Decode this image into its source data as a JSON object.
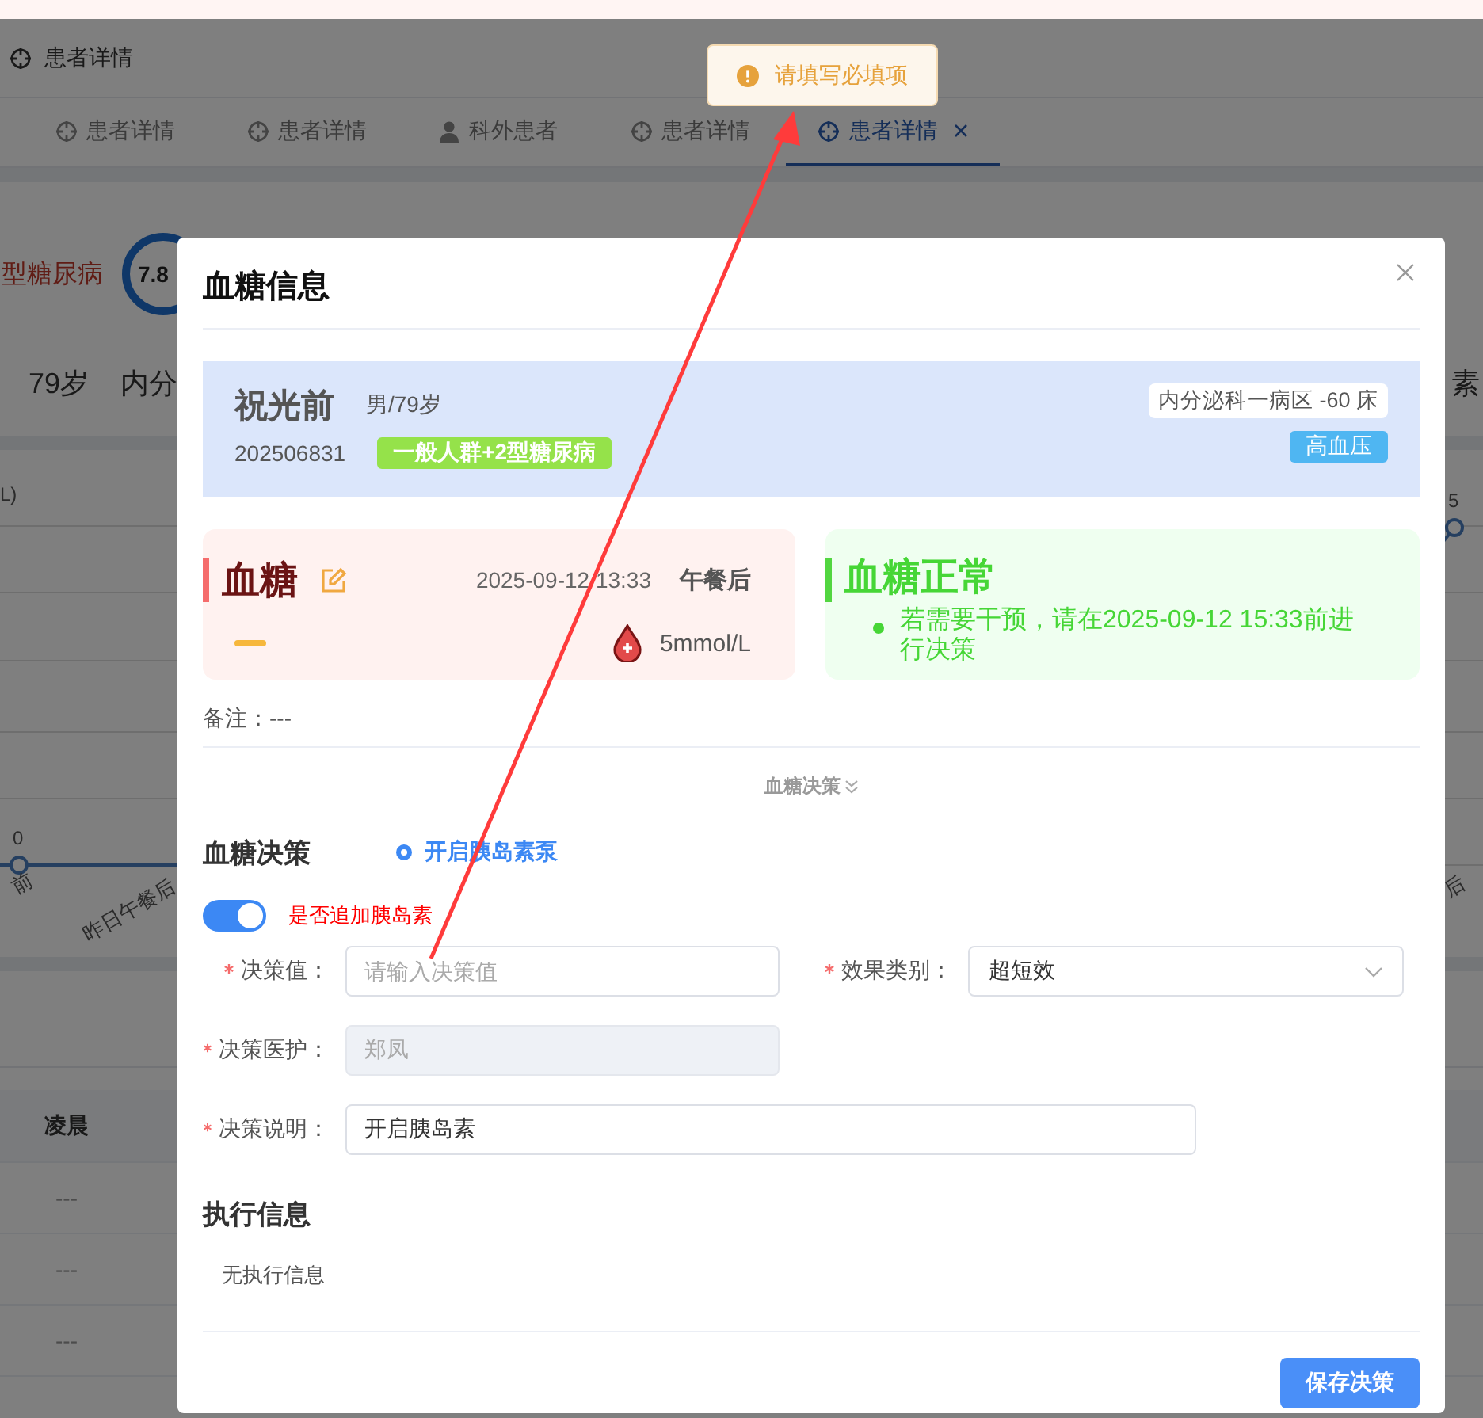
{
  "page": {
    "header_title": "患者详情",
    "tabs": [
      {
        "label": "患者详情",
        "kind": "detail",
        "selected": false,
        "closable": false
      },
      {
        "label": "患者详情",
        "kind": "detail",
        "selected": false,
        "closable": false
      },
      {
        "label": "科外患者",
        "kind": "person",
        "selected": false,
        "closable": false
      },
      {
        "label": "患者详情",
        "kind": "detail",
        "selected": false,
        "closable": false
      },
      {
        "label": "患者详情",
        "kind": "detail",
        "selected": true,
        "closable": true
      }
    ],
    "summary": {
      "diagnosis": "型糖尿病",
      "score": "7.8",
      "age": "79岁",
      "dept": "内分",
      "right_text": "素"
    },
    "chart": {
      "unit": "L)",
      "left_value": "0",
      "right_value": "5",
      "x_labels": [
        "前",
        "昨日午餐后",
        "后"
      ]
    },
    "table": {
      "columns": [
        "凌晨"
      ],
      "rows": [
        [
          "---"
        ],
        [
          "---"
        ],
        [
          "---"
        ]
      ]
    }
  },
  "toast": {
    "kind": "warning",
    "message": "请填写必填项"
  },
  "dialog": {
    "title": "血糖信息",
    "patient": {
      "name": "祝光前",
      "sex_age": "男/79岁",
      "id": "202506831",
      "group_tag": "一般人群+2型糖尿病",
      "ward": "内分泌科一病区 -60 床",
      "condition_tag": "高血压"
    },
    "reading": {
      "title": "血糖",
      "time": "2025-09-12 13:33",
      "meal": "午餐后",
      "value": "5mmol/L"
    },
    "status": {
      "title": "血糖正常",
      "advice": "若需要干预，请在2025-09-12 15:33前进行决策"
    },
    "note": "备注：---",
    "section_toggle": "血糖决策",
    "decision": {
      "title": "血糖决策",
      "option": {
        "label": "开启胰岛素泵",
        "selected": true
      },
      "add_insulin": {
        "label": "是否追加胰岛素",
        "on": true
      },
      "rows": [
        [
          {
            "label": "决策值：",
            "required": true,
            "kind": "input",
            "placeholder": "请输入决策值"
          },
          {
            "label": "效果类别：",
            "required": true,
            "kind": "select",
            "value": "超短效"
          }
        ],
        [
          {
            "label": "决策医护：",
            "required": true,
            "kind": "input",
            "value": "郑凤",
            "disabled": true
          }
        ],
        [
          {
            "label": "决策说明：",
            "required": true,
            "kind": "input",
            "value": "开启胰岛素"
          }
        ]
      ]
    },
    "execution": {
      "title": "执行信息",
      "empty_text": "无执行信息"
    },
    "save_button": "保存决策"
  }
}
